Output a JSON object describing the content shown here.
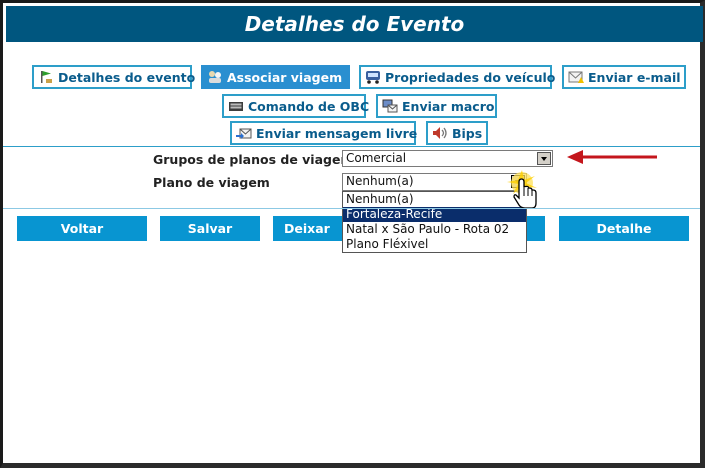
{
  "page": {
    "title": "Detalhes do Evento"
  },
  "tabs": [
    {
      "label": "Detalhes do evento",
      "icon": "flag-icon"
    },
    {
      "label": "Associar viagem",
      "icon": "people-icon",
      "active": true
    },
    {
      "label": "Propriedades do veículo",
      "icon": "truck-icon"
    },
    {
      "label": "Enviar e-mail",
      "icon": "envelope-warning-icon"
    },
    {
      "label": "Comando de OBC",
      "icon": "keyboard-icon"
    },
    {
      "label": "Enviar macro",
      "icon": "envelope-computer-icon"
    },
    {
      "label": "Enviar mensagem livre",
      "icon": "envelope-arrow-icon"
    },
    {
      "label": "Bips",
      "icon": "speaker-icon"
    }
  ],
  "form": {
    "grupos_label": "Grupos de planos de viagem",
    "grupos_value": "Comercial",
    "plano_label": "Plano de viagem",
    "plano_value": "Nenhum(a)",
    "plano_options": [
      "Nenhum(a)",
      "Fortaleza-Recife",
      "Natal x São Paulo - Rota 02",
      "Plano Fléxivel"
    ],
    "plano_highlighted": "Fortaleza-Recife"
  },
  "buttons": {
    "voltar": "Voltar",
    "salvar": "Salvar",
    "deixar": "Deixar Pe",
    "detalhe": "Detalhe"
  },
  "colors": {
    "header": "#00567f",
    "tab_border": "#2d9ec9",
    "active_tab": "#2a8fd0",
    "button": "#0895d1",
    "arrow": "#c4161c"
  }
}
